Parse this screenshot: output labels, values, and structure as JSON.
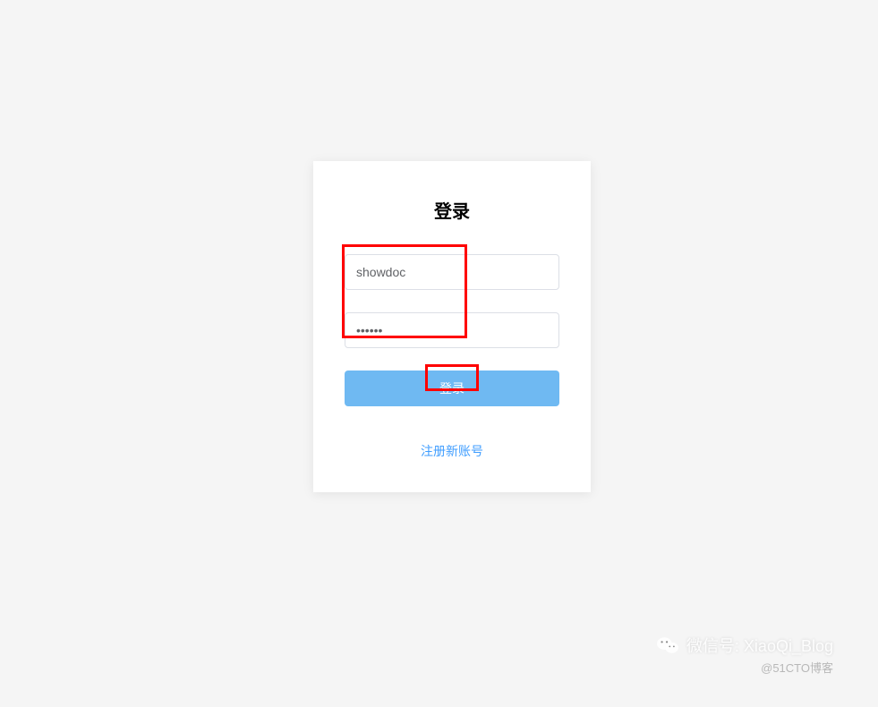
{
  "login": {
    "title": "登录",
    "username_value": "showdoc",
    "password_value": "••••••",
    "button_label": "登录",
    "register_link": "注册新账号"
  },
  "watermark": {
    "wechat_prefix": "微信号:",
    "wechat_id": "XiaoQi_Blog",
    "blog_credit": "@51CTO博客"
  },
  "colors": {
    "primary": "#409eff",
    "button": "#6fb9f2",
    "highlight": "#ff0000"
  }
}
